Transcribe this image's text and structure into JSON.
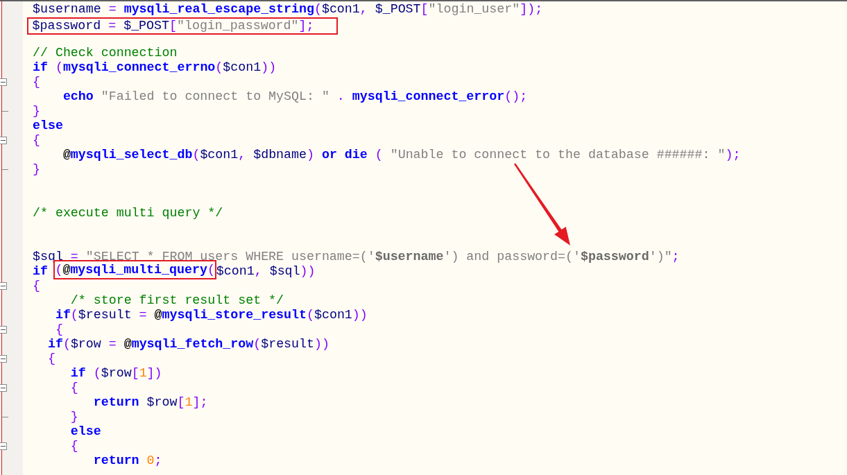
{
  "lines": [
    {
      "kind": "code",
      "tokens": [
        {
          "kind": "var",
          "text": "$username"
        },
        {
          "kind": "op",
          "text": " = "
        },
        {
          "kind": "fn",
          "text": "mysqli_real_escape_string"
        },
        {
          "kind": "op",
          "text": "("
        },
        {
          "kind": "var",
          "text": "$con1"
        },
        {
          "kind": "op",
          "text": ", "
        },
        {
          "kind": "var",
          "text": "$_POST"
        },
        {
          "kind": "op",
          "text": "["
        },
        {
          "kind": "str",
          "text": "\"login_user\""
        },
        {
          "kind": "op",
          "text": "]);"
        }
      ]
    },
    {
      "kind": "code",
      "tokens": [
        {
          "kind": "frame",
          "tokens": [
            {
              "kind": "var",
              "text": "$password"
            },
            {
              "kind": "op",
              "text": " = "
            },
            {
              "kind": "var",
              "text": "$_POST"
            },
            {
              "kind": "op",
              "text": "["
            },
            {
              "kind": "str",
              "text": "\"login_password\""
            },
            {
              "kind": "op",
              "text": "];"
            }
          ]
        }
      ]
    },
    {
      "kind": "blank"
    },
    {
      "kind": "code",
      "tokens": [
        {
          "kind": "comment",
          "text": "// Check connection"
        }
      ]
    },
    {
      "kind": "code",
      "tokens": [
        {
          "kind": "kw",
          "text": "if"
        },
        {
          "kind": "op",
          "text": " ("
        },
        {
          "kind": "fn",
          "text": "mysqli_connect_errno"
        },
        {
          "kind": "op",
          "text": "("
        },
        {
          "kind": "var",
          "text": "$con1"
        },
        {
          "kind": "op",
          "text": "))"
        }
      ]
    },
    {
      "kind": "code",
      "expanded": true,
      "tokens": [
        {
          "kind": "op",
          "text": "{"
        }
      ]
    },
    {
      "kind": "code",
      "tokens": [
        {
          "kind": "kw",
          "text": "    echo"
        },
        {
          "kind": "str",
          "text": " \"Failed to connect to MySQL: \""
        },
        {
          "kind": "op",
          "text": " . "
        },
        {
          "kind": "fn",
          "text": "mysqli_connect_error"
        },
        {
          "kind": "op",
          "text": "();"
        }
      ]
    },
    {
      "kind": "code",
      "block_end": true,
      "tokens": [
        {
          "kind": "op",
          "text": "}"
        }
      ]
    },
    {
      "kind": "code",
      "tokens": [
        {
          "kind": "kw",
          "text": "else"
        }
      ]
    },
    {
      "kind": "code",
      "expanded": true,
      "tokens": [
        {
          "kind": "op",
          "text": "{"
        }
      ]
    },
    {
      "kind": "code",
      "tokens": [
        {
          "kind": "at",
          "text": "    @"
        },
        {
          "kind": "fn",
          "text": "mysqli_select_db"
        },
        {
          "kind": "op",
          "text": "("
        },
        {
          "kind": "var",
          "text": "$con1"
        },
        {
          "kind": "op",
          "text": ", "
        },
        {
          "kind": "var",
          "text": "$dbname"
        },
        {
          "kind": "op",
          "text": ") "
        },
        {
          "kind": "kw",
          "text": "or die"
        },
        {
          "kind": "op",
          "text": " ( "
        },
        {
          "kind": "str",
          "text": "\"Unable to connect to the database ######: \""
        },
        {
          "kind": "op",
          "text": ");"
        }
      ]
    },
    {
      "kind": "code",
      "block_end": true,
      "tokens": [
        {
          "kind": "op",
          "text": "}"
        }
      ]
    },
    {
      "kind": "blank"
    },
    {
      "kind": "blank"
    },
    {
      "kind": "code",
      "tokens": [
        {
          "kind": "comment",
          "text": "/* execute multi query */"
        }
      ]
    },
    {
      "kind": "blank"
    },
    {
      "kind": "blank"
    },
    {
      "kind": "code",
      "tokens": [
        {
          "kind": "var",
          "text": "$sql"
        },
        {
          "kind": "op",
          "text": " = "
        },
        {
          "kind": "str",
          "text": "\"SELECT * FROM users WHERE username=('"
        },
        {
          "kind": "strvar",
          "text": "$username"
        },
        {
          "kind": "str",
          "text": "') and password=('"
        },
        {
          "kind": "strvar",
          "text": "$password"
        },
        {
          "kind": "str",
          "text": "')\""
        },
        {
          "kind": "op",
          "text": ";"
        }
      ]
    },
    {
      "kind": "code",
      "tokens": [
        {
          "kind": "kw",
          "text": "if "
        },
        {
          "kind": "frame",
          "tokens": [
            {
              "kind": "op",
              "text": "("
            },
            {
              "kind": "at",
              "text": "@"
            },
            {
              "kind": "fn",
              "text": "mysqli_multi_query"
            },
            {
              "kind": "op",
              "text": "("
            }
          ]
        },
        {
          "kind": "var",
          "text": "$con1"
        },
        {
          "kind": "op",
          "text": ", "
        },
        {
          "kind": "var",
          "text": "$sql"
        },
        {
          "kind": "op",
          "text": "))"
        }
      ]
    },
    {
      "kind": "code",
      "expanded": true,
      "tokens": [
        {
          "kind": "op",
          "text": "{"
        }
      ]
    },
    {
      "kind": "code",
      "tokens": [
        {
          "kind": "comment",
          "text": "     /* store first result set */"
        }
      ]
    },
    {
      "kind": "code",
      "tokens": [
        {
          "kind": "kw",
          "text": "   if"
        },
        {
          "kind": "op",
          "text": "("
        },
        {
          "kind": "var",
          "text": "$result"
        },
        {
          "kind": "op",
          "text": " = "
        },
        {
          "kind": "at",
          "text": "@"
        },
        {
          "kind": "fn",
          "text": "mysqli_store_result"
        },
        {
          "kind": "op",
          "text": "("
        },
        {
          "kind": "var",
          "text": "$con1"
        },
        {
          "kind": "op",
          "text": "))"
        }
      ]
    },
    {
      "kind": "code",
      "expanded": true,
      "tokens": [
        {
          "kind": "op",
          "text": "   {"
        }
      ]
    },
    {
      "kind": "code",
      "tokens": [
        {
          "kind": "kw",
          "text": "  if"
        },
        {
          "kind": "op",
          "text": "("
        },
        {
          "kind": "var",
          "text": "$row"
        },
        {
          "kind": "op",
          "text": " = "
        },
        {
          "kind": "at",
          "text": "@"
        },
        {
          "kind": "fn",
          "text": "mysqli_fetch_row"
        },
        {
          "kind": "op",
          "text": "("
        },
        {
          "kind": "var",
          "text": "$result"
        },
        {
          "kind": "op",
          "text": "))"
        }
      ]
    },
    {
      "kind": "code",
      "expanded": true,
      "tokens": [
        {
          "kind": "op",
          "text": "  {"
        }
      ]
    },
    {
      "kind": "code",
      "tokens": [
        {
          "kind": "kw",
          "text": "     if"
        },
        {
          "kind": "op",
          "text": " ("
        },
        {
          "kind": "var",
          "text": "$row"
        },
        {
          "kind": "op",
          "text": "["
        },
        {
          "kind": "num",
          "text": "1"
        },
        {
          "kind": "op",
          "text": "])"
        }
      ]
    },
    {
      "kind": "code",
      "expanded": true,
      "tokens": [
        {
          "kind": "op",
          "text": "     {"
        }
      ]
    },
    {
      "kind": "code",
      "tokens": [
        {
          "kind": "kw",
          "text": "        return"
        },
        {
          "kind": "var",
          "text": " $row"
        },
        {
          "kind": "op",
          "text": "["
        },
        {
          "kind": "num",
          "text": "1"
        },
        {
          "kind": "op",
          "text": "];"
        }
      ]
    },
    {
      "kind": "code",
      "block_end": true,
      "tokens": [
        {
          "kind": "op",
          "text": "     }"
        }
      ]
    },
    {
      "kind": "code",
      "tokens": [
        {
          "kind": "kw",
          "text": "     else"
        }
      ]
    },
    {
      "kind": "code",
      "expanded": true,
      "tokens": [
        {
          "kind": "op",
          "text": "     {"
        }
      ]
    },
    {
      "kind": "code",
      "tokens": [
        {
          "kind": "kw",
          "text": "        return"
        },
        {
          "kind": "num",
          "text": " 0"
        },
        {
          "kind": "op",
          "text": ";"
        }
      ]
    }
  ],
  "annotations": [
    {
      "kind": "arrow"
    }
  ]
}
